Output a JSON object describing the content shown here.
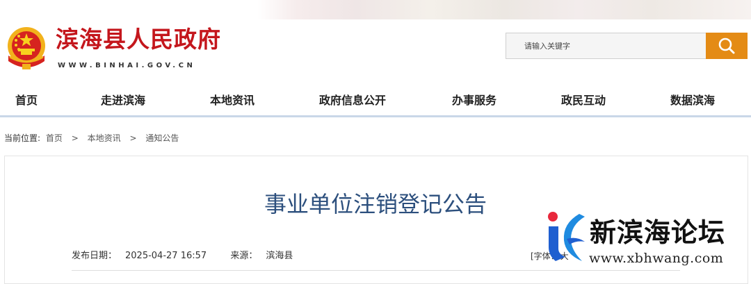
{
  "header": {
    "site_name": "滨海县人民政府",
    "site_url": "WWW.BINHAI.GOV.CN",
    "search_placeholder": "请输入关键字",
    "colors": {
      "brand_red": "#c4161c",
      "search_button": "#e48b15",
      "title_blue": "#2c4f7d"
    }
  },
  "nav": {
    "items": [
      {
        "label": "首页"
      },
      {
        "label": "走进滨海"
      },
      {
        "label": "本地资讯"
      },
      {
        "label": "政府信息公开"
      },
      {
        "label": "办事服务"
      },
      {
        "label": "政民互动"
      },
      {
        "label": "数据滨海"
      }
    ]
  },
  "breadcrumb": {
    "label": "当前位置:",
    "items": [
      "首页",
      "本地资讯",
      "通知公告"
    ],
    "separator": ">"
  },
  "article": {
    "title": "事业单位注销登记公告",
    "publish_label": "发布日期：",
    "publish_date": "2025-04-27 16:57",
    "source_label": "来源：",
    "source": "滨海县",
    "font_label": "[字体：",
    "font_large": "大"
  },
  "watermark": {
    "name": "新滨海论坛",
    "url": "www.xbhwang.com"
  }
}
